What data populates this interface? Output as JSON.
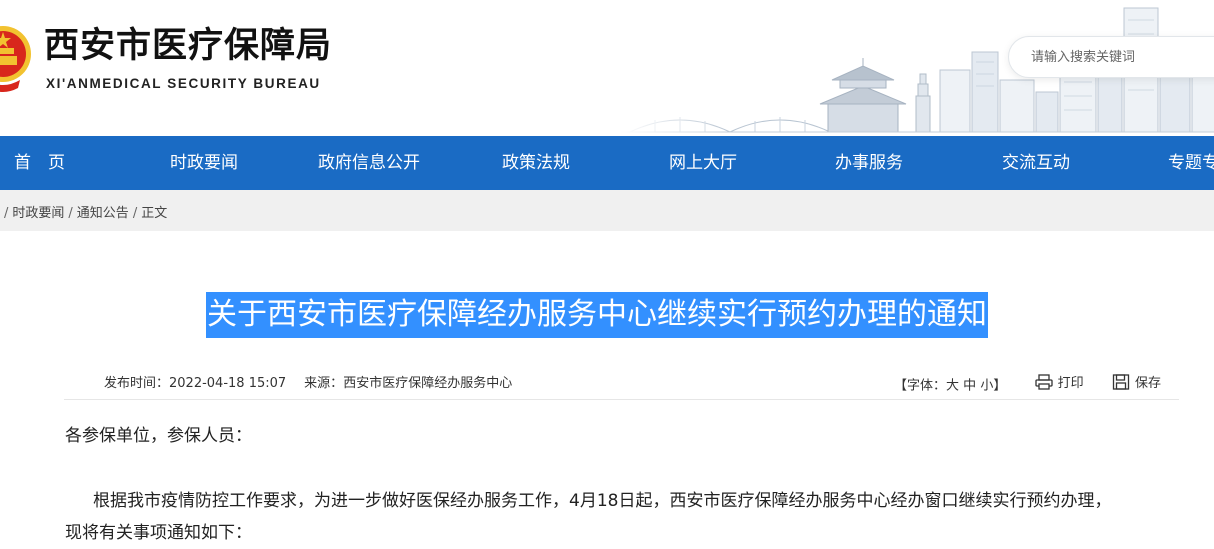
{
  "header": {
    "title": "西安市医疗保障局",
    "subtitle": "XI'ANMEDICAL SECURITY BUREAU",
    "search_placeholder": "请输入搜索关键词"
  },
  "nav": {
    "items": [
      "首　页",
      "时政要闻",
      "政府信息公开",
      "政策法规",
      "网上大厅",
      "办事服务",
      "交流互动",
      "专题专栏"
    ]
  },
  "breadcrumb": [
    "时政要闻",
    "通知公告",
    "正文"
  ],
  "article": {
    "title": "关于西安市医疗保障经办服务中心继续实行预约办理的通知",
    "publish_label": "发布时间：",
    "publish_time": "2022-04-18 15:07",
    "source_label": "来源：",
    "source": "西安市医疗保障经办服务中心",
    "font_label": "【字体：",
    "font_large": "大",
    "font_medium": "中",
    "font_small": "小",
    "font_end": "】",
    "print_label": "打印",
    "save_label": "保存",
    "greeting": "各参保单位，参保人员：",
    "body_line1": "根据我市疫情防控工作要求，为进一步做好医保经办服务工作，4月18日起，西安市医疗保障经办服务中心经办窗口继续实行预约办理，",
    "body_line2": "现将有关事项通知如下："
  },
  "colors": {
    "nav_bg": "#1a6bc4",
    "title_highlight": "#3390ff",
    "breadcrumb_bg": "#f0f0f0",
    "emblem_red": "#d8261c",
    "emblem_gold": "#f2c230"
  },
  "icons": {
    "emblem": "national-emblem",
    "print": "printer-icon",
    "save": "save-icon"
  }
}
